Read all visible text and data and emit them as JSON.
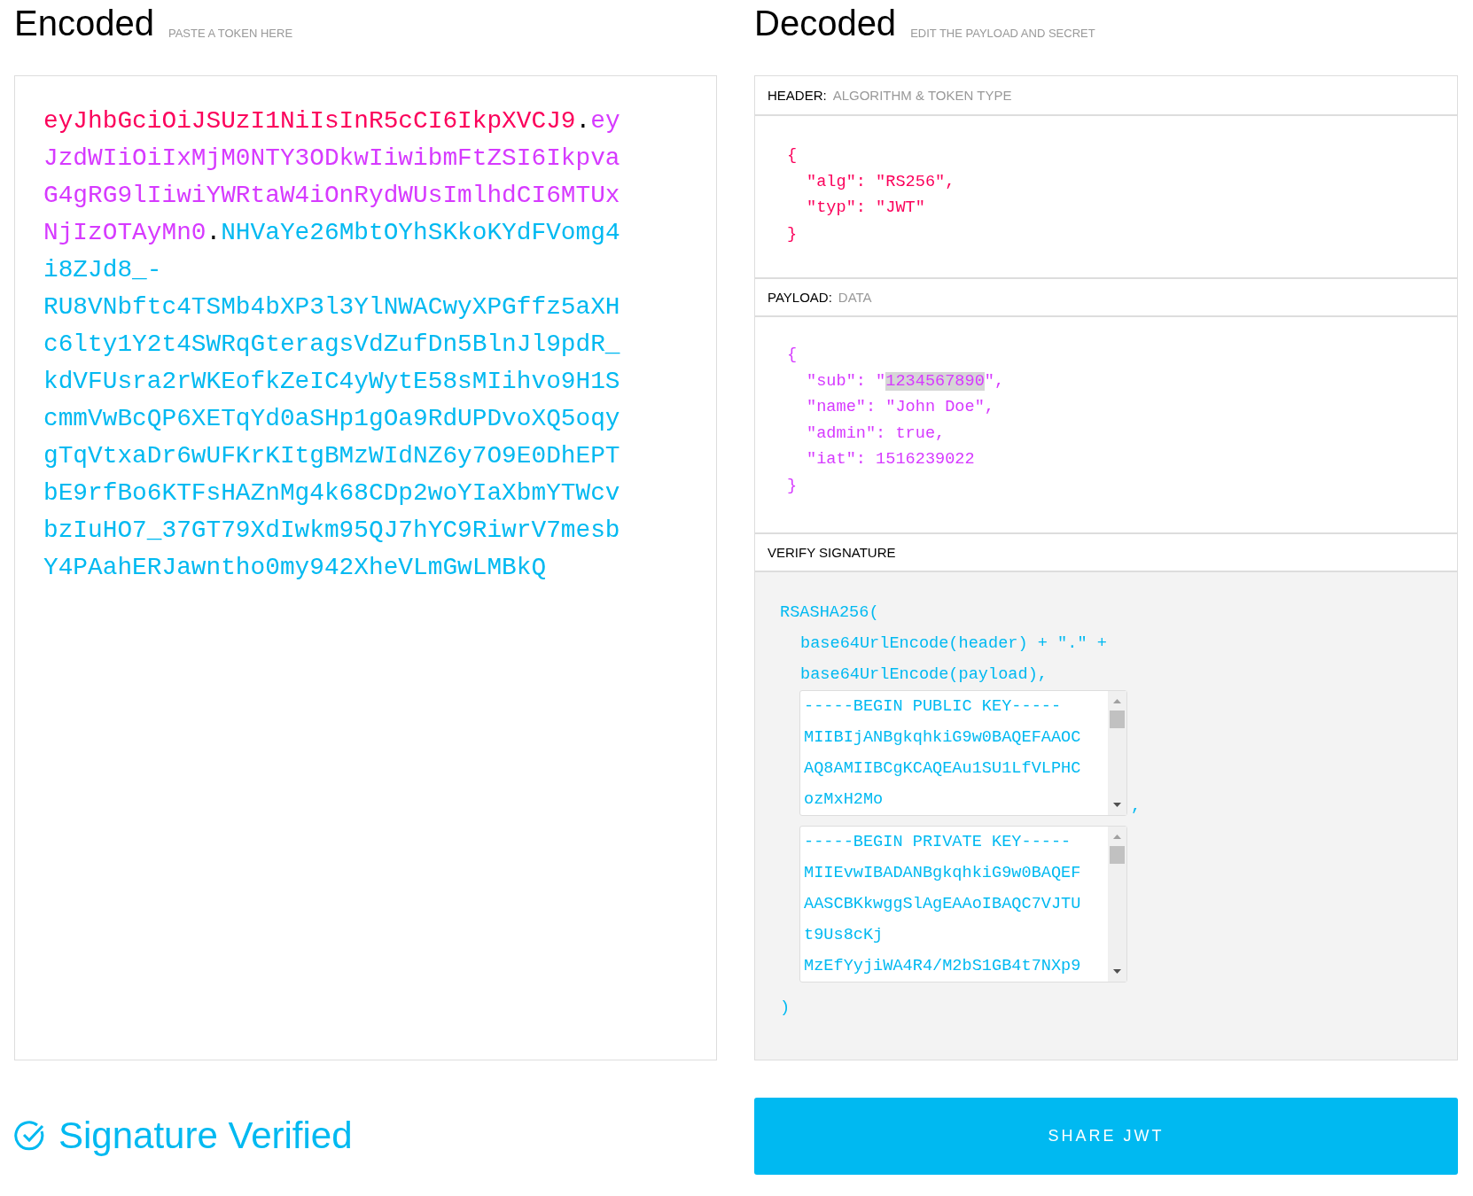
{
  "encoded": {
    "title": "Encoded",
    "subtitle": "PASTE A TOKEN HERE",
    "token": [
      {
        "kind": "header",
        "text": "eyJhbGciOiJSUzI1NiIsInR5cCI6IkpXVCJ9"
      },
      {
        "kind": "dot",
        "text": "."
      },
      {
        "kind": "payload",
        "text": "eyJzdWIiOiIxMjM0NTY3ODkwIiwibmFtZSI6IkpvaG4gRG9lIiwiYWRtaW4iOnRydWUsImlhdCI6MTUxNjIzOTAyMn0"
      },
      {
        "kind": "dot",
        "text": "."
      },
      {
        "kind": "signature",
        "text": "NHVaYe26MbtOYhSKkoKYdFVomg4i8ZJd8_-RU8VNbftc4TSMb4bXP3l3YlNWACwyXPGffz5aXHc6lty1Y2t4SWRqGteragsVdZufDn5BlnJl9pdR_kdVFUsra2rWKEofkZeIC4yWytE58sMIihvo9H1ScmmVwBcQP6XETqYd0aSHp1gOa9RdUPDvoXQ5oqygTqVtxaDr6wUFKrKItgBMzWIdNZ6y7O9E0DhEPTbE9rfBo6KTFsHAZnMg4k68CDp2woYIaXbmYTWcvbzIuHO7_37GT79XdIwkm95QJ7hYC9RiwrV7mesbY4PAahERJawntho0my942XheVLmGwLMBkQ"
      }
    ]
  },
  "decoded": {
    "title": "Decoded",
    "subtitle": "EDIT THE PAYLOAD AND SECRET",
    "header": {
      "label": "HEADER:",
      "sublabel": "ALGORITHM & TOKEN TYPE",
      "lines": [
        {
          "kind": "brace",
          "text": "{"
        },
        {
          "kind": "entry",
          "text": "\"alg\": \"RS256\","
        },
        {
          "kind": "entry",
          "text": "\"typ\": \"JWT\""
        },
        {
          "kind": "brace",
          "text": "}"
        }
      ]
    },
    "payload": {
      "label": "PAYLOAD:",
      "sublabel": "DATA",
      "lines": [
        {
          "kind": "brace",
          "text": "{"
        },
        {
          "kind": "entry",
          "text": "\"sub\": \"",
          "selected_text": "1234567890",
          "after": "\","
        },
        {
          "kind": "entry",
          "text": "\"name\": \"John Doe\","
        },
        {
          "kind": "entry",
          "text": "\"admin\": true,"
        },
        {
          "kind": "entry",
          "text": "\"iat\": 1516239022"
        },
        {
          "kind": "brace",
          "text": "}"
        }
      ]
    },
    "signature": {
      "label": "VERIFY SIGNATURE",
      "function": "RSASHA256(",
      "args": [
        "base64UrlEncode(header) + \".\" +",
        "base64UrlEncode(payload),"
      ],
      "public_key": {
        "lines": [
          "-----BEGIN PUBLIC KEY-----",
          "MIIBIjANBgkqhkiG9w0BAQEFAAOC",
          "AQ8AMIIBCgKCAQEAu1SU1LfVLPHC",
          "ozMxH2Mo"
        ]
      },
      "separator": ",",
      "private_key": {
        "lines": [
          "-----BEGIN PRIVATE KEY-----",
          "MIIEvwIBADANBgkqhkiG9w0BAQEF",
          "AASCBKkwggSlAgEAAoIBAQC7VJTU",
          "t9Us8cKj",
          "MzEfYyjiWA4R4/M2bS1GB4t7NXp9"
        ]
      },
      "close": ")"
    }
  },
  "status": {
    "text": "Signature Verified",
    "verified": true
  },
  "share_button": "SHARE JWT"
}
